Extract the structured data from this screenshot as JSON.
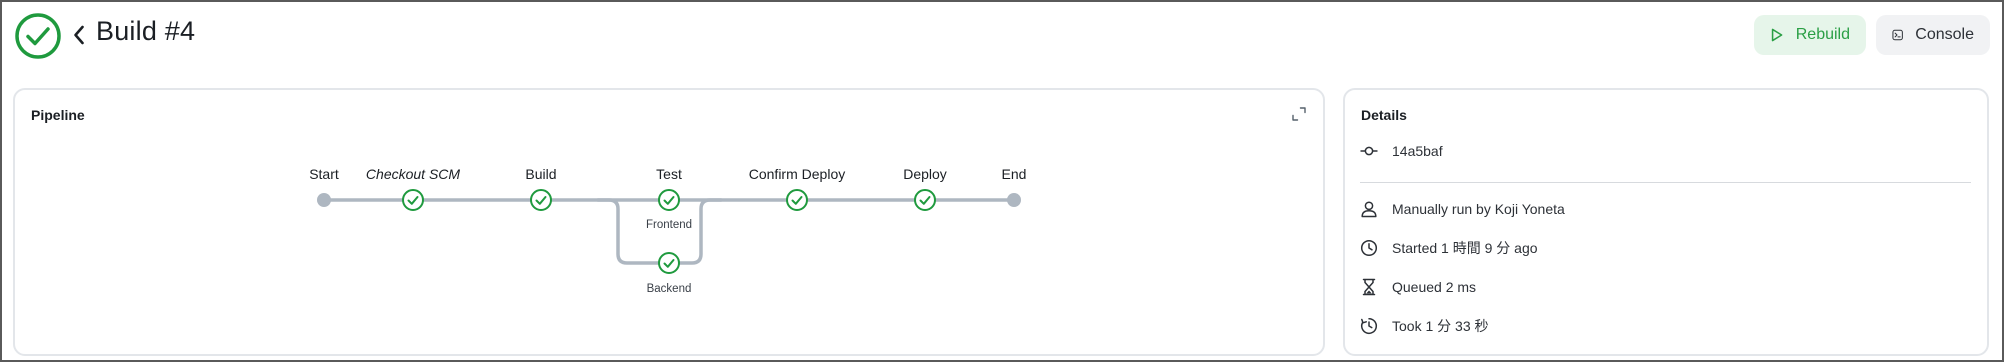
{
  "header": {
    "title": "Build #4",
    "status_icon": "success-check-icon",
    "back_icon": "chevron-left-icon"
  },
  "toolbar": {
    "rebuild_label": "Rebuild",
    "console_label": "Console"
  },
  "pipeline": {
    "title": "Pipeline",
    "stages": [
      {
        "label": "Start",
        "status": "start"
      },
      {
        "label": "Checkout SCM",
        "status": "success"
      },
      {
        "label": "Build",
        "status": "success"
      },
      {
        "label": "Test",
        "status": "success",
        "branches": [
          "Frontend",
          "Backend"
        ]
      },
      {
        "label": "Confirm Deploy",
        "status": "success"
      },
      {
        "label": "Deploy",
        "status": "success"
      },
      {
        "label": "End",
        "status": "end"
      }
    ]
  },
  "details": {
    "title": "Details",
    "commit": "14a5baf",
    "trigger": "Manually run by Koji Yoneta",
    "started": "Started 1 時間 9 分 ago",
    "queued": "Queued 2 ms",
    "took": "Took 1 分 33 秒"
  },
  "colors": {
    "success": "#1f9a3e",
    "success_bg": "#e6f5ea",
    "track": "#aeb7c1",
    "border": "#e3e6ea"
  }
}
